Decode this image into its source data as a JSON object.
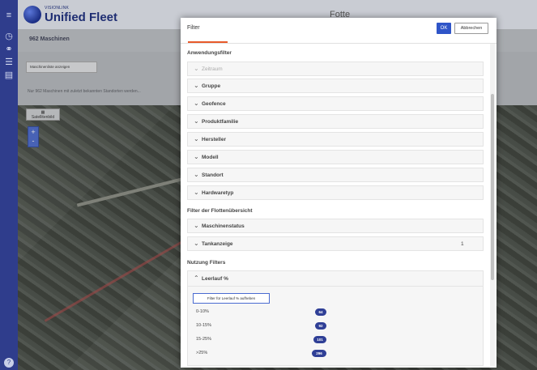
{
  "app": {
    "logo_subtitle": "VISIONLINK",
    "title": "Unified Fleet",
    "header_center": "Fotte"
  },
  "page": {
    "machine_count": "962 Maschinen",
    "show_machines_button": "Maschinenliste anzeigen",
    "info_text": "Nur 962 Maschinen mit zuletzt bekannten Standorten werden...",
    "map_layer_button": "Satellitenbild",
    "zoom_in": "+",
    "zoom_out": "-"
  },
  "dialog": {
    "title": "Filter",
    "ok_label": "OK",
    "cancel_label": "Abbrechen",
    "section_application": "Anwendungsfilter",
    "application_filters": [
      {
        "label": "Zeitraum",
        "expanded": false,
        "disabled": true
      },
      {
        "label": "Gruppe",
        "expanded": false
      },
      {
        "label": "Geofence",
        "expanded": false
      },
      {
        "label": "Produktfamilie",
        "expanded": false
      },
      {
        "label": "Hersteller",
        "expanded": false
      },
      {
        "label": "Modell",
        "expanded": false
      },
      {
        "label": "Standort",
        "expanded": false
      },
      {
        "label": "Hardwaretyp",
        "expanded": false
      }
    ],
    "section_fleet": "Filter der Flottenübersicht",
    "fleet_filters": [
      {
        "label": "Maschinenstatus",
        "count": ""
      },
      {
        "label": "Tankanzeige",
        "count": "1"
      }
    ],
    "section_usage": "Nutzung Filters",
    "usage_filter": {
      "label": "Leerlauf %",
      "expanded": true,
      "clear_button": "Filter für Leerlauf % aufheben",
      "buckets": [
        {
          "range": "0-10%",
          "count": "64"
        },
        {
          "range": "10-15%",
          "count": "92"
        },
        {
          "range": "15-25%",
          "count": "101"
        },
        {
          "range": ">25%",
          "count": "296"
        }
      ]
    }
  },
  "icons": {
    "chevron_down": "chevron-down-icon",
    "chevron_up": "chevron-up-icon"
  },
  "colors": {
    "brand_blue": "#2f3d8c",
    "ok_button": "#2f55c8",
    "tab_accent": "#e85a2a"
  }
}
